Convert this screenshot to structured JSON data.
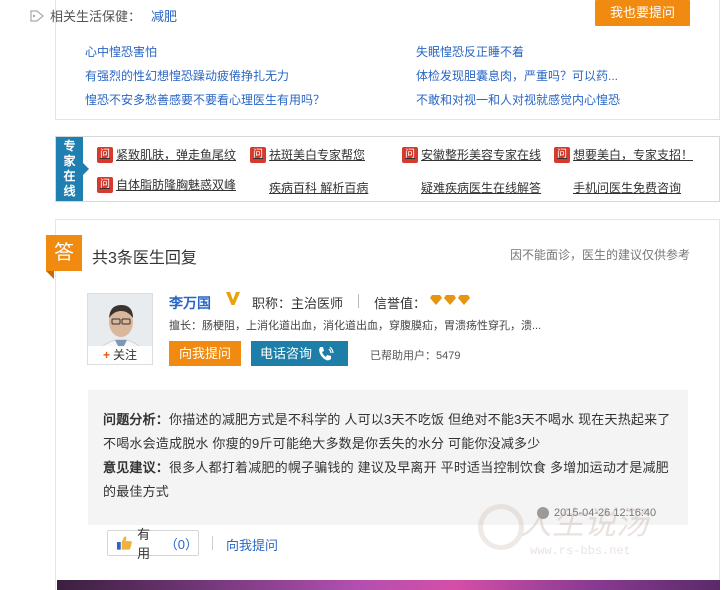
{
  "related": {
    "label": "相关生活保健：",
    "tag": "减肥",
    "ask_button": "我也要提问",
    "links": [
      "心中惶恐害怕",
      "失眠惶恐反正睡不着",
      "有强烈的性幻想惶恐躁动疲倦挣扎无力",
      "体检发现胆囊息肉，严重吗？可以药...",
      "惶恐不安多愁善感要不要看心理医生有用吗？",
      "不敢和对视一和人对视就感觉内心惶恐"
    ]
  },
  "expert": {
    "label": "专家在线",
    "items": [
      {
        "text": "紧致肌肤，弹走鱼尾纹",
        "badge": true
      },
      {
        "text": "祛斑美白专家帮您",
        "badge": true
      },
      {
        "text": "安徽整形美容专家在线",
        "badge": true
      },
      {
        "text": "想要美白，专家支招！",
        "badge": true
      },
      {
        "text": "自体脂肪隆胸魅惑双峰",
        "badge": true
      },
      {
        "text": "疾病百科 解析百病",
        "badge": false
      },
      {
        "text": "疑难疾病医生在线解答",
        "badge": false
      },
      {
        "text": "手机问医生免费咨询",
        "badge": false
      }
    ],
    "badge_char": "问"
  },
  "answers": {
    "tag": "答",
    "count_text": "共3条医生回复",
    "disclaimer": "因不能面诊，医生的建议仅供参考",
    "doctor": {
      "follow": "关注",
      "name": "李万国",
      "title_label": "职称：主治医师",
      "trust_label": "信誉值：",
      "trust_level": 3,
      "specialty": "擅长：肠梗阻，上消化道出血，消化道出血，穿腹膜疝，胃溃疡性穿孔，溃...",
      "ask_button": "向我提问",
      "call_button": "电话咨询",
      "helped": "已帮助用户：5479"
    },
    "analysis_label": "问题分析：",
    "analysis_text": "你描述的减肥方式是不科学的 人可以3天不吃饭 但绝对不能3天不喝水 现在天热起来了 不喝水会造成脱水 你瘦的9斤可能绝大多数是你丢失的水分 可能你没减多少",
    "advice_label": "意见建议：",
    "advice_text": "很多人都打着减肥的幌子骗钱的 建议及早离开 平时适当控制饮食 多增加运动才是减肥的最佳方式",
    "timestamp": "2015-04-26 12:16:40",
    "useful_label": "有用",
    "useful_count": "（0）",
    "ask_link": "向我提问"
  },
  "watermark": {
    "text": "人生说汤",
    "url": "www.rs-bbs.net"
  },
  "colors": {
    "link": "#2a66c3",
    "orange": "#f08a10",
    "teal": "#1d7fa8",
    "badge_red": "#d53a2c"
  }
}
